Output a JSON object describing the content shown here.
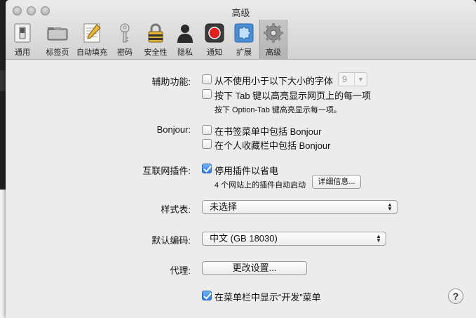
{
  "window": {
    "title": "高级"
  },
  "toolbar": {
    "items": [
      {
        "label": "通用",
        "icon": "switch-icon"
      },
      {
        "label": "标签页",
        "icon": "tabs-icon"
      },
      {
        "label": "自动填充",
        "icon": "autofill-icon"
      },
      {
        "label": "密码",
        "icon": "key-icon"
      },
      {
        "label": "安全性",
        "icon": "lock-icon"
      },
      {
        "label": "隐私",
        "icon": "person-icon"
      },
      {
        "label": "通知",
        "icon": "record-icon"
      },
      {
        "label": "扩展",
        "icon": "puzzle-icon"
      },
      {
        "label": "高级",
        "icon": "gear-icon",
        "selected": true
      }
    ]
  },
  "accessibility": {
    "label": "辅助功能:",
    "min_font_label": "从不使用小于以下大小的字体",
    "min_font_checked": false,
    "min_font_value": "9",
    "tab_highlight_label": "按下 Tab 键以高亮显示网页上的每一项",
    "tab_highlight_checked": false,
    "tab_note": "按下 Option-Tab 键高亮显示每一项。"
  },
  "bonjour": {
    "label": "Bonjour:",
    "bookmarks_menu_label": "在书签菜单中包括 Bonjour",
    "bookmarks_menu_checked": false,
    "favorites_bar_label": "在个人收藏栏中包括 Bonjour",
    "favorites_bar_checked": false
  },
  "plugins": {
    "label": "互联网插件:",
    "power_saver_label": "停用插件以省电",
    "power_saver_checked": true,
    "note": "4 个网站上的插件自动启动",
    "details_button": "详细信息..."
  },
  "stylesheet": {
    "label": "样式表:",
    "value": "未选择"
  },
  "encoding": {
    "label": "默认编码:",
    "value": "中文 (GB 18030)"
  },
  "proxy": {
    "label": "代理:",
    "button": "更改设置..."
  },
  "develop": {
    "label": "在菜单栏中显示“开发”菜单",
    "checked": true
  },
  "help": {
    "glyph": "?"
  },
  "colors": {
    "checkbox_on": "#2a7ae4",
    "window_bg": "#ececec"
  }
}
